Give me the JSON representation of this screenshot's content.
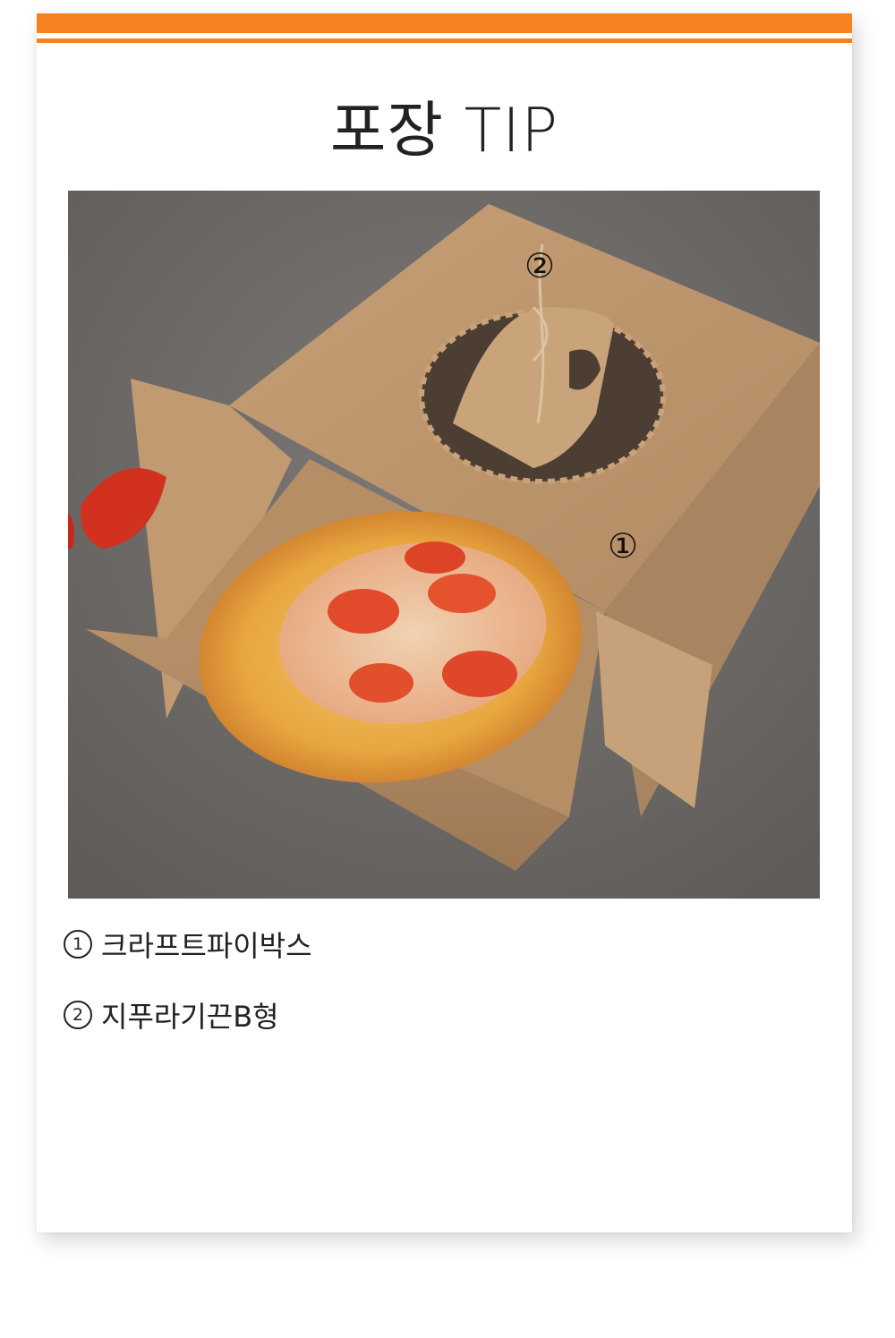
{
  "header": {
    "title": "포장 TIP",
    "accent_color": "#f5821f"
  },
  "photo": {
    "subject": "kraft pie box with galette",
    "markers": [
      "②",
      "①"
    ]
  },
  "captions": [
    {
      "num": "1",
      "text": "크라프트파이박스"
    },
    {
      "num": "2",
      "text": "지푸라기끈B형"
    }
  ]
}
